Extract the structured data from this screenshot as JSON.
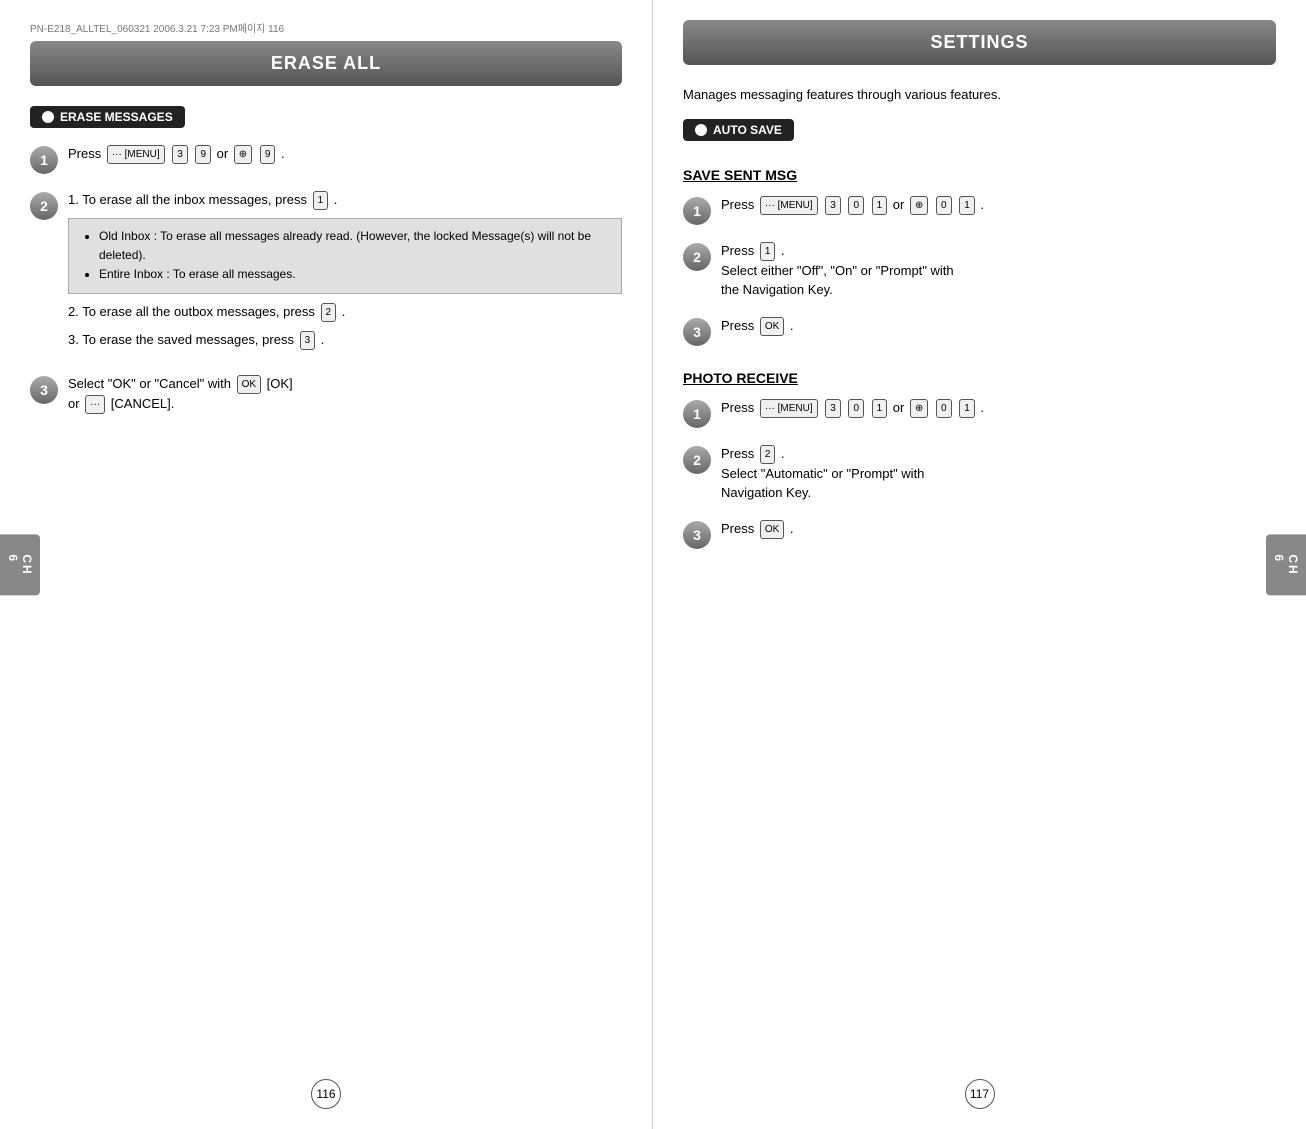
{
  "left_page": {
    "top_info": "PN-E218_ALLTEL_060321  2006.3.21 7:23 PM페이지 116",
    "header": "ERASE ALL",
    "section_label": "ERASE MESSAGES",
    "step1": {
      "number": "1",
      "text_before": "Press",
      "menu_key": "··· [MENU]",
      "key1": "3ᵐ",
      "key2": "9ᵐ",
      "or_text": "or",
      "nav_key": "⊕",
      "key3": "9ᵐ"
    },
    "step2": {
      "number": "2",
      "line1": "1. To erase all the inbox messages, press",
      "line1_key": "1ᵐᶜ",
      "bullet1": "Old Inbox : To erase all messages already read. (However, the locked Message(s) will not be deleted).",
      "bullet2": "Entire Inbox : To erase all messages.",
      "line2": "2. To erase all the outbox messages, press",
      "line2_key": "2ᵃᵇ",
      "line3": "3. To erase the saved messages, press",
      "line3_key": "3ᵐ"
    },
    "step3": {
      "number": "3",
      "text1": "Select \"OK\" or \"Cancel\" with",
      "ok_key": "OK",
      "bracket_ok": "[OK]",
      "or_text": "or",
      "cancel_key": "···",
      "bracket_cancel": "[CANCEL]."
    },
    "page_number": "116",
    "ch_label": "CH\n6"
  },
  "right_page": {
    "header": "SETTINGS",
    "desc": "Manages messaging features through various features.",
    "section_label": "AUTO SAVE",
    "subsection1": {
      "title": "SAVE SENT MSG",
      "step1": {
        "number": "1",
        "text": "Press",
        "menu_key": "··· [MENU]",
        "keys": "3ᵐ 0ᵛ 1ᵐᶜ",
        "or_text": "or",
        "nav_keys": "⊕ 0ᵛ 1ᵐᶜ"
      },
      "step2": {
        "number": "2",
        "line1_key": "1ᵐᶜ",
        "line1_suffix": ".",
        "line2": "Select either \"Off\", \"On\" or \"Prompt\" with",
        "line3": "the Navigation Key."
      },
      "step3": {
        "number": "3",
        "text": "Press",
        "ok_key": "OK",
        "period": "."
      }
    },
    "subsection2": {
      "title": "PHOTO RECEIVE",
      "step1": {
        "number": "1",
        "text": "Press",
        "menu_key": "··· [MENU]",
        "keys": "3ᵐ 0ᵛ 1ᵐᶜ",
        "or_text": "or",
        "nav_keys": "⊕ 0ᵛ 1ᵐᶜ"
      },
      "step2": {
        "number": "2",
        "line1_key": "2ᵃᵇ",
        "line1_suffix": ".",
        "line2": "Select \"Automatic\" or \"Prompt\" with",
        "line3": "Navigation Key."
      },
      "step3": {
        "number": "3",
        "text": "Press",
        "ok_key": "OK",
        "period": "."
      }
    },
    "page_number": "117",
    "ch_label": "CH\n6"
  }
}
